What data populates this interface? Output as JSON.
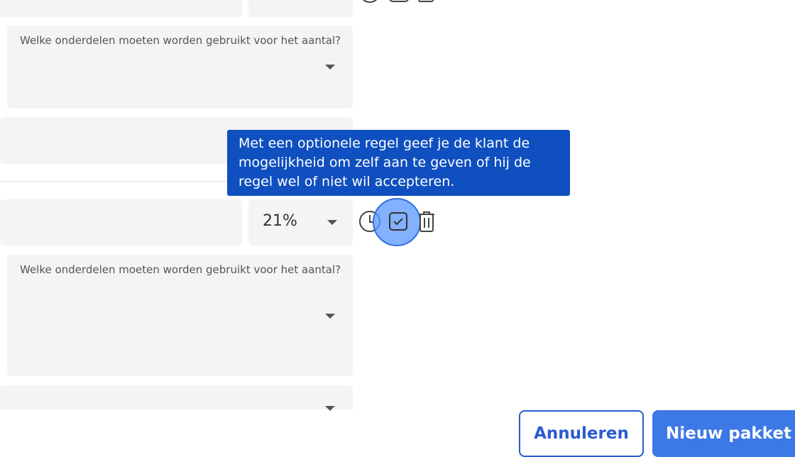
{
  "rule_1": {
    "units_label": "Welke onderdelen moeten worden gebruikt voor het aantal?"
  },
  "rule_2": {
    "vat_value": "21%",
    "units_label": "Welke onderdelen moeten worden gebruikt voor het aantal?"
  },
  "tooltip": {
    "text": "Met een optionele regel geef je de klant de mogelijkheid om zelf aan te geven of hij de regel wel of niet wil accepteren."
  },
  "footer": {
    "cancel_label": "Annuleren",
    "new_label": "Nieuw pakket"
  },
  "icons": {
    "time": "clock-icon",
    "optional": "checkbox-icon",
    "delete": "trash-icon"
  },
  "colors": {
    "tooltip_bg": "#0f4fbf",
    "primary": "#3c78e6",
    "field_bg": "#f4f4f4"
  }
}
